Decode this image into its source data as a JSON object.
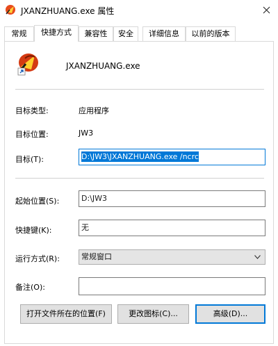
{
  "window": {
    "title": "JXANZHUANG.exe 属性"
  },
  "tabs": [
    {
      "label": "常规"
    },
    {
      "label": "快捷方式"
    },
    {
      "label": "兼容性"
    },
    {
      "label": "安全"
    },
    {
      "label": "详细信息"
    },
    {
      "label": "以前的版本"
    }
  ],
  "shortcut": {
    "file_name": "JXANZHUANG.exe",
    "target_type_label": "目标类型:",
    "target_type_value": "应用程序",
    "target_location_label": "目标位置:",
    "target_location_value": "JW3",
    "target_label": "目标(T):",
    "target_value": "D:\\JW3\\JXANZHUANG.exe /ncrc",
    "start_in_label": "起始位置(S):",
    "start_in_value": "D:\\JW3",
    "hotkey_label": "快捷键(K):",
    "hotkey_value": "无",
    "run_label": "运行方式(R):",
    "run_value": "常规窗口",
    "comment_label": "备注(O):",
    "comment_value": ""
  },
  "buttons": {
    "open_location": "打开文件所在的位置(F)",
    "change_icon": "更改图标(C)...",
    "advanced": "高级(D)..."
  },
  "icons": {
    "app": "game-logo-icon",
    "close": "close-icon",
    "dropdown": "chevron-down-icon"
  },
  "colors": {
    "selection": "#0078d7",
    "border": "#d9d9d9"
  }
}
